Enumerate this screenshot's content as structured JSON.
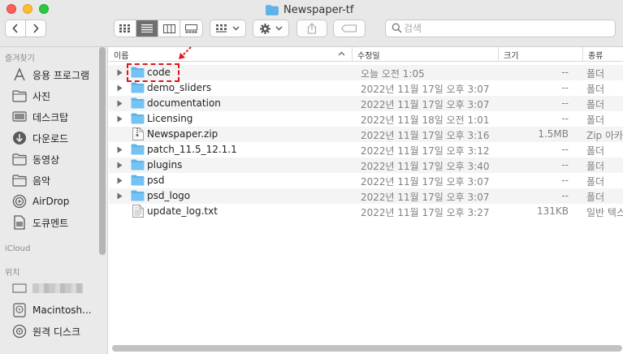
{
  "window": {
    "title": "Newspaper-tf"
  },
  "toolbar": {
    "search_placeholder": "검색",
    "icons": {
      "back": "chevron-left-icon",
      "forward": "chevron-right-icon",
      "icon_view": "grid-icon",
      "list_view": "list-icon",
      "column_view": "columns-icon",
      "gallery_view": "gallery-icon",
      "group": "group-icon",
      "action": "gear-icon",
      "share": "share-icon",
      "tag": "tag-icon",
      "search": "search-icon"
    },
    "active_view": "list"
  },
  "sidebar": {
    "favorites_header": "즐겨찾기",
    "favorites": [
      {
        "label": "응용 프로그램",
        "icon": "applications-icon"
      },
      {
        "label": "사진",
        "icon": "folder-icon"
      },
      {
        "label": "데스크탑",
        "icon": "desktop-icon"
      },
      {
        "label": "다운로드",
        "icon": "downloads-icon"
      },
      {
        "label": "동영상",
        "icon": "folder-icon"
      },
      {
        "label": "음악",
        "icon": "folder-icon"
      },
      {
        "label": "AirDrop",
        "icon": "airdrop-icon"
      },
      {
        "label": "도큐멘트",
        "icon": "documents-icon"
      }
    ],
    "icloud_header": "iCloud",
    "locations_header": "위치",
    "locations": [
      {
        "label": "",
        "icon": "computer-icon",
        "redacted": true
      },
      {
        "label": "Macintosh...",
        "icon": "hard-drive-icon"
      },
      {
        "label": "원격 디스크",
        "icon": "disc-icon"
      }
    ]
  },
  "columns": {
    "name": "이름",
    "date": "수정일",
    "size": "크기",
    "kind": "종류"
  },
  "files": [
    {
      "name": "code",
      "date": "오늘 오전 1:05",
      "size": "--",
      "kind": "폴더",
      "type": "folder",
      "highlighted": true
    },
    {
      "name": "demo_sliders",
      "date": "2022년 11월 17일 오후 3:07",
      "size": "--",
      "kind": "폴더",
      "type": "folder"
    },
    {
      "name": "documentation",
      "date": "2022년 11월 17일 오후 3:07",
      "size": "--",
      "kind": "폴더",
      "type": "folder"
    },
    {
      "name": "Licensing",
      "date": "2022년 11월 18일 오전 1:01",
      "size": "--",
      "kind": "폴더",
      "type": "folder"
    },
    {
      "name": "Newspaper.zip",
      "date": "2022년 11월 17일 오후 3:16",
      "size": "1.5MB",
      "kind": "Zip 아카이브",
      "type": "file"
    },
    {
      "name": "patch_11.5_12.1.1",
      "date": "2022년 11월 17일 오후 3:12",
      "size": "--",
      "kind": "폴더",
      "type": "folder"
    },
    {
      "name": "plugins",
      "date": "2022년 11월 17일 오후 3:40",
      "size": "--",
      "kind": "폴더",
      "type": "folder"
    },
    {
      "name": "psd",
      "date": "2022년 11월 17일 오후 3:07",
      "size": "--",
      "kind": "폴더",
      "type": "folder"
    },
    {
      "name": "psd_logo",
      "date": "2022년 11월 17일 오후 3:07",
      "size": "--",
      "kind": "폴더",
      "type": "folder"
    },
    {
      "name": "update_log.txt",
      "date": "2022년 11월 17일 오후 3:27",
      "size": "131KB",
      "kind": "일반 텍스트",
      "type": "file"
    }
  ],
  "colors": {
    "folder": "#5fb3ea",
    "annotation": "#e0151b",
    "sidebar_bg": "#ebeaea",
    "titlebar_bg": "#e9e8e9"
  }
}
